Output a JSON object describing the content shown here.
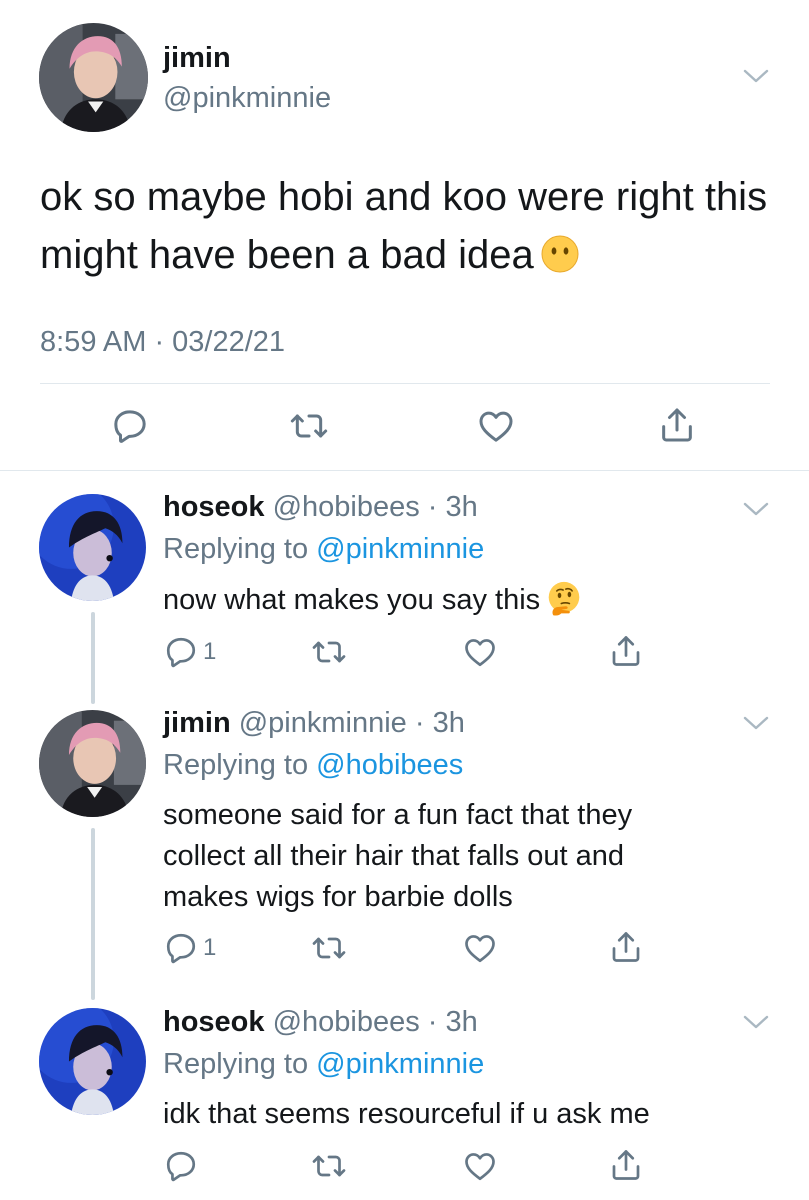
{
  "main_tweet": {
    "name": "jimin",
    "handle": "@pinkminnie",
    "text": "ok so maybe hobi and koo were right this might have been a bad idea",
    "emoji": "no-mouth-face-emoji",
    "timestamp": "8:59 AM · 03/22/21"
  },
  "replies": [
    {
      "name": "hoseok",
      "meta": "@hobibees · 3h",
      "replying_prefix": "Replying to ",
      "replying_to": "@pinkminnie",
      "text": "now what makes you say this",
      "emoji": "thinking-face-emoji",
      "reply_count": "1"
    },
    {
      "name": "jimin",
      "meta": "@pinkminnie · 3h",
      "replying_prefix": "Replying to ",
      "replying_to": "@hobibees",
      "text": "someone said for a fun fact that they collect all their hair that falls out and makes wigs for barbie dolls",
      "reply_count": "1"
    },
    {
      "name": "hoseok",
      "meta": "@hobibees · 3h",
      "replying_prefix": "Replying to ",
      "replying_to": "@pinkminnie",
      "text": "idk that seems resourceful if u ask me",
      "reply_count": ""
    }
  ],
  "colors": {
    "text": "#14171a",
    "secondary": "#657786",
    "link": "#1b95e0",
    "divider": "#e1e8ed",
    "thread_line": "#ccd6dd"
  },
  "icons": [
    "reply-icon",
    "retweet-icon",
    "like-icon",
    "share-icon",
    "chevron-down-icon"
  ]
}
